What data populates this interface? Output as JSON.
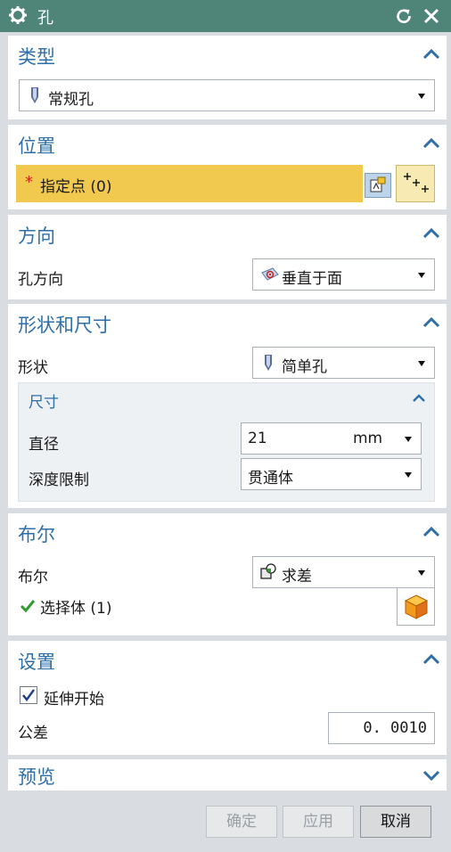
{
  "window": {
    "title": "孔"
  },
  "sections": {
    "type": {
      "title": "类型",
      "selected": "常规孔"
    },
    "position": {
      "title": "位置",
      "specify_point": "指定点 (0)",
      "required_marker": "*"
    },
    "direction": {
      "title": "方向",
      "hole_direction_label": "孔方向",
      "hole_direction_value": "垂直于面"
    },
    "shape": {
      "title": "形状和尺寸",
      "shape_label": "形状",
      "shape_value": "简单孔",
      "dimensions": {
        "title": "尺寸",
        "diameter_label": "直径",
        "diameter_value": "21",
        "diameter_unit": "mm",
        "depth_limit_label": "深度限制",
        "depth_limit_value": "贯通体"
      }
    },
    "boolean": {
      "title": "布尔",
      "boolean_label": "布尔",
      "boolean_value": "求差",
      "select_body": "选择体 (1)"
    },
    "settings": {
      "title": "设置",
      "extend_start_label": "延伸开始",
      "extend_start_checked": true,
      "tolerance_label": "公差",
      "tolerance_value": "0. 0010"
    },
    "preview": {
      "title": "预览"
    }
  },
  "footer": {
    "ok": "确定",
    "apply": "应用",
    "cancel": "取消"
  },
  "colors": {
    "titlebar": "#4f8478",
    "section_title": "#2e6fa8",
    "highlight_row": "#f0c94e",
    "panel_bg": "#d9dde1"
  }
}
